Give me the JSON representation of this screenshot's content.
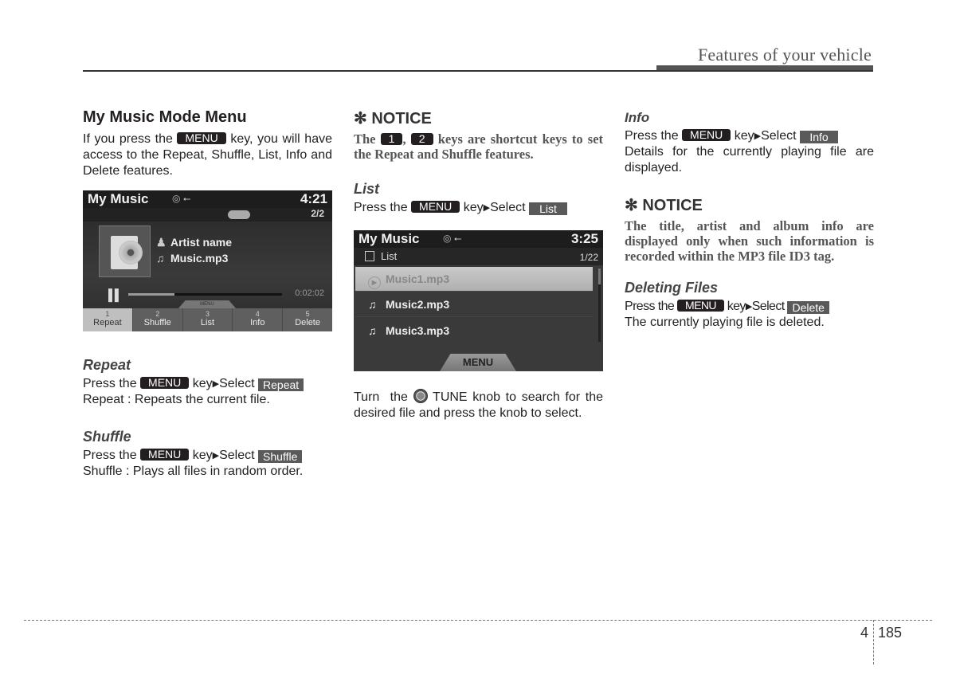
{
  "header": {
    "title": "Features of your vehicle"
  },
  "col1": {
    "section_title": "My Music Mode Menu",
    "intro_pre": "If you press the",
    "intro_key": "MENU",
    "intro_post": "key, you will have access to the Repeat, Shuffle, List, Info and Delete features.",
    "screen": {
      "title": "My Music",
      "source": "◎ ⭠",
      "time": "4:21",
      "count": "2/2",
      "artist": "Artist name",
      "file": "Music.mp3",
      "progress": 0.3,
      "elapsed": "0:02:02",
      "menu_tab": "MENU",
      "softkeys": [
        {
          "num": "1",
          "label": "Repeat"
        },
        {
          "num": "2",
          "label": "Shuffle"
        },
        {
          "num": "3",
          "label": "List"
        },
        {
          "num": "4",
          "label": "Info"
        },
        {
          "num": "5",
          "label": "Delete"
        }
      ]
    },
    "repeat": {
      "title": "Repeat",
      "press": "Press the",
      "key": "MENU",
      "select": "key",
      "select_word": "Select",
      "option": "Repeat",
      "desc": "Repeat : Repeats the current file."
    },
    "shuffle": {
      "title": "Shuffle",
      "press": "Press the",
      "key": "MENU",
      "select": "key",
      "select_word": "Select",
      "option": "Shuffle",
      "desc": "Shuffle : Plays all files in random order."
    }
  },
  "col2": {
    "notice": {
      "title": "✻ NOTICE",
      "pre": "The",
      "key1": "1",
      "sep": ",",
      "key2": "2",
      "post": "keys are shortcut keys to set the Repeat and Shuffle features."
    },
    "list": {
      "title": "List",
      "press": "Press the",
      "key": "MENU",
      "select": "key",
      "select_word": "Select",
      "option": "List"
    },
    "screen": {
      "title": "My Music",
      "source": "◎ ⭠",
      "time": "3:25",
      "list_label": "List",
      "count": "1/22",
      "rows": [
        "Music1.mp3",
        "Music2.mp3",
        "Music3.mp3"
      ],
      "menu": "MENU"
    },
    "tune_pre": "Turn  the",
    "tune_post": "TUNE knob to search for the desired file and press the knob to select."
  },
  "col3": {
    "info": {
      "title": "Info",
      "press": "Press the",
      "key": "MENU",
      "select": "key",
      "select_word": "Select",
      "option": "Info",
      "desc": "Details for the currently playing file are displayed."
    },
    "notice": {
      "title": "✻ NOTICE",
      "text": "The title, artist and album info are displayed only when such information is recorded within the MP3 file ID3 tag."
    },
    "delete": {
      "title": "Deleting Files",
      "press": "Press the",
      "key": "MENU",
      "select": "key",
      "select_word": "Select",
      "option": "Delete",
      "desc": "The currently playing file is deleted."
    }
  },
  "footer": {
    "chapter": "4",
    "page": "185"
  }
}
